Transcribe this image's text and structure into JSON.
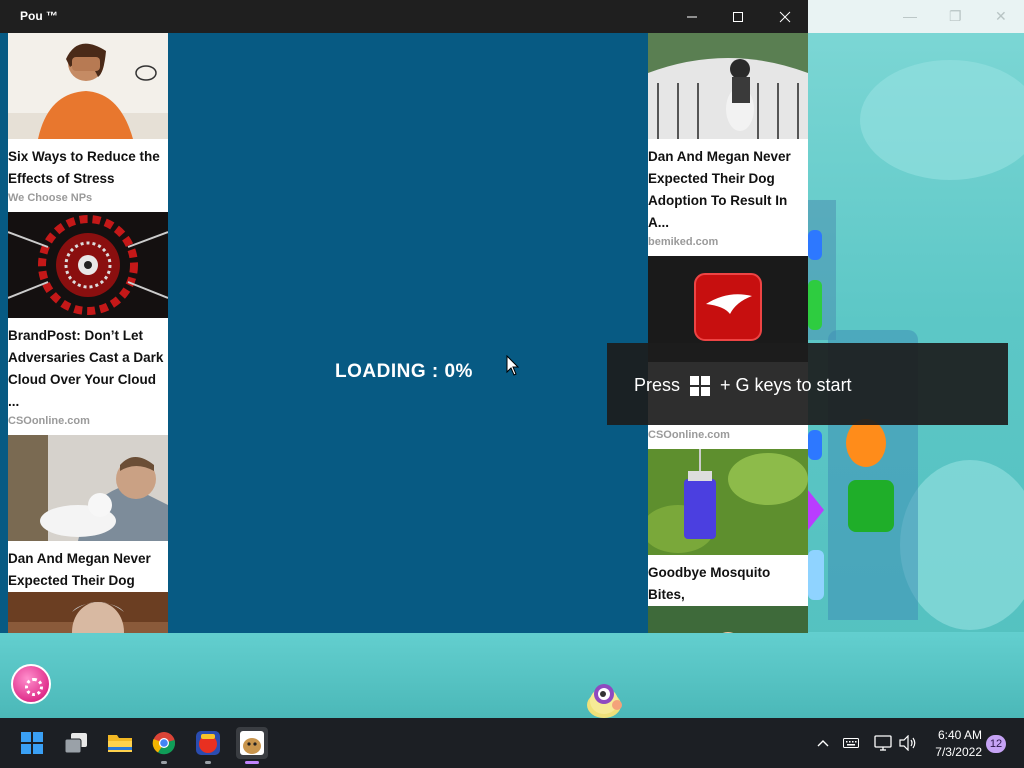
{
  "window": {
    "title": "Pou ™"
  },
  "loading": {
    "text": "LOADING : 0%"
  },
  "ads_left": [
    {
      "headline": "Six Ways to Reduce the Effects of Stress",
      "source": "We Choose NPs"
    },
    {
      "headline": "BrandPost: Don’t Let Adversaries Cast a Dark Cloud Over Your Cloud ...",
      "source": "CSOonline.com"
    },
    {
      "headline": "Dan And Megan Never Expected Their Dog",
      "source": ""
    }
  ],
  "ads_right": [
    {
      "headline": "Dan And Megan Never Expected Their Dog Adoption To Result In A...",
      "source": "bemiked.com"
    },
    {
      "headline": "",
      "source": "CSOonline.com"
    },
    {
      "headline": "Goodbye Mosquito Bites,",
      "source": ""
    }
  ],
  "toast": {
    "text_before": "Press",
    "text_after": "+ G keys to start"
  },
  "taskbar": {
    "time": "6:40 AM",
    "date": "7/3/2022",
    "notifications": "12"
  },
  "icons": {
    "start": "windows-start-icon",
    "task_view": "task-view-icon",
    "explorer": "file-explorer-icon",
    "chrome": "chrome-icon",
    "game": "candy-crush-icon",
    "pou": "pou-icon"
  }
}
